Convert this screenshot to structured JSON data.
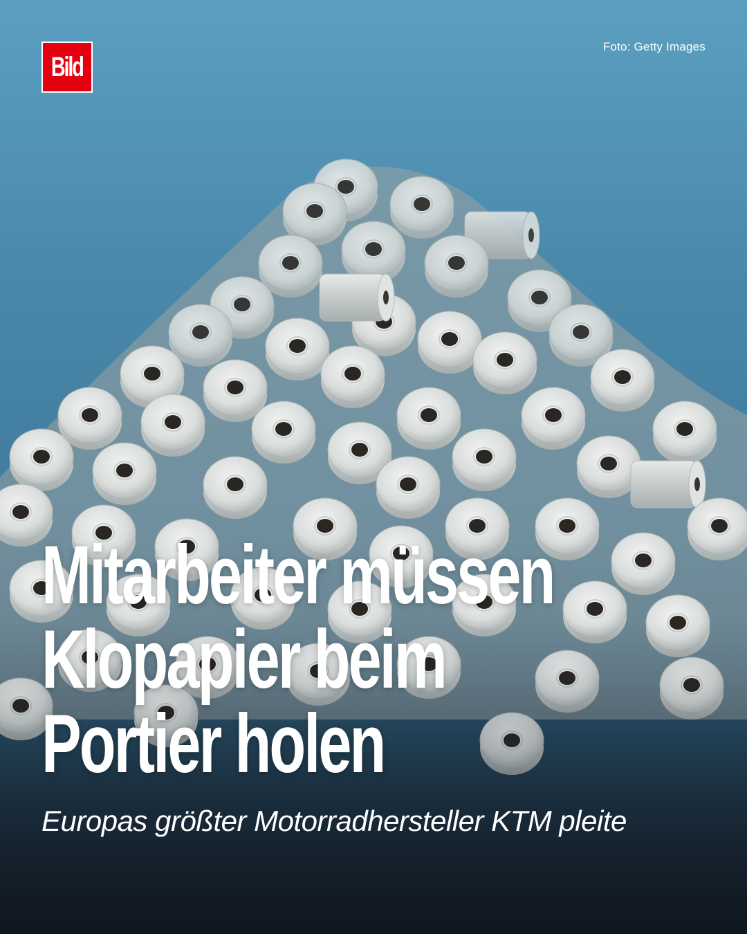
{
  "brand": {
    "logo_text": "Bild",
    "logo_color": "#e3000f"
  },
  "photo": {
    "credit": "Foto: Getty Images",
    "subject_icon": "toilet-paper-pile"
  },
  "headline": {
    "lines": [
      "Mitarbeiter müssen",
      "Klopapier beim",
      "Portier holen"
    ]
  },
  "subline": "Europas größter Motorradhersteller KTM pleite",
  "colors": {
    "background_top": "#5b9fc0",
    "background_bottom": "#141f2a",
    "text": "#ffffff"
  }
}
